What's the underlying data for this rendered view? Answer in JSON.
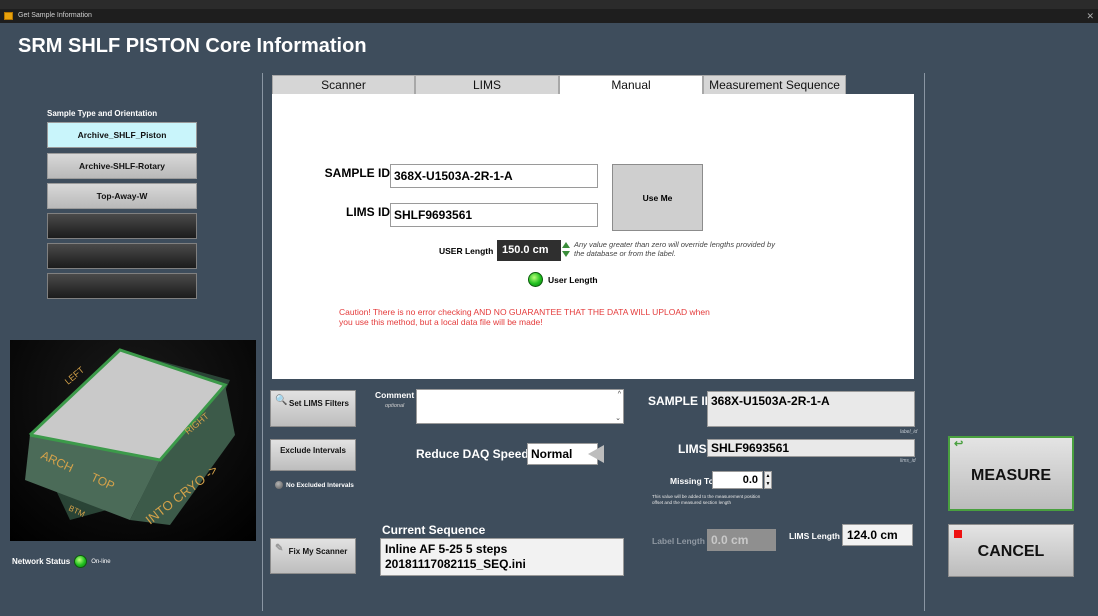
{
  "window": {
    "title": "Get Sample Information"
  },
  "page_title": "SRM SHLF PISTON Core Information",
  "sample_type": {
    "label": "Sample Type and Orientation",
    "buttons": [
      "Archive_SHLF_Piston",
      "Archive-SHLF-Rotary",
      "Top-Away-W",
      "",
      "",
      ""
    ],
    "active_index": 0
  },
  "core_labels": {
    "left": "LEFT",
    "right": "RIGHT",
    "arch": "ARCH",
    "top": "TOP",
    "btm": "BTM",
    "into_cryo": "INTO CRYO ->"
  },
  "network": {
    "label": "Network Status",
    "state": "On-line"
  },
  "tabs": [
    "Scanner",
    "LIMS",
    "Manual",
    "Measurement Sequence"
  ],
  "active_tab": "Manual",
  "manual": {
    "sample_id_label": "SAMPLE ID",
    "sample_id_value": "368X-U1503A-2R-1-A",
    "lims_id_label": "LIMS ID",
    "lims_id_value": "SHLF9693561",
    "use_me": "Use Me",
    "user_length_label": "USER Length",
    "user_length_value": "150.0 cm",
    "user_length_note": "Any value greater than zero will override lengths provided by the database or from the label.",
    "user_length_indicator": "User Length",
    "caution": "Caution! There is no error checking AND NO GUARANTEE THAT THE DATA WILL UPLOAD when you use this method, but a local data file will be made!"
  },
  "controls": {
    "set_lims_filters": "Set LIMS Filters",
    "exclude_intervals": "Exclude Intervals",
    "no_excluded": "No Excluded Intervals",
    "fix_my_scanner": "Fix My Scanner",
    "comment_label": "Comment",
    "comment_optional": "optional",
    "comment_value": "",
    "reduce_daq_label": "Reduce DAQ Speed",
    "reduce_daq_value": "Normal",
    "current_sequence_label": "Current Sequence",
    "current_sequence_line1": "Inline AF 5-25 5 steps",
    "current_sequence_line2": "20181117082115_SEQ.ini"
  },
  "summary": {
    "sample_id_label": "SAMPLE ID",
    "sample_id_value": "368X-U1503A-2R-1-A",
    "label_id_tag": "label_id",
    "lims_id_label": "LIMS ID",
    "lims_id_value": "SHLF9693561",
    "lims_id_tag": "lims_id",
    "missing_top_label": "Missing Top",
    "missing_top_value": "0.0",
    "missing_top_note": "This value will be added to the measurement position offset and the measured section length",
    "label_length_label": "Label Length",
    "label_length_value": "0.0 cm",
    "lims_length_label": "LIMS Length",
    "lims_length_value": "124.0 cm"
  },
  "actions": {
    "measure": "MEASURE",
    "cancel": "CANCEL"
  },
  "colors": {
    "background": "#3e4d5c",
    "active_sample": "#c9f5fb",
    "caution": "#e43b3b",
    "led_on": "#1fbf1f",
    "measure_border": "#49a03f"
  }
}
